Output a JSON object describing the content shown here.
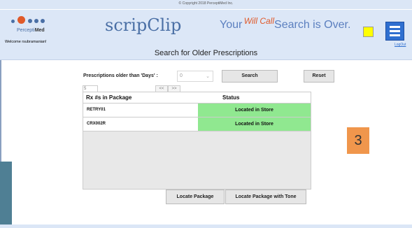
{
  "copyright": "© Copyright 2018 PerceptiMed Inc.",
  "logo": {
    "prefix": "Percepti",
    "suffix": "Med"
  },
  "welcome": "Welcome rsubramanian!",
  "brand": "scripClip",
  "tagline": {
    "prefix": "Your ",
    "accent": "Will Call",
    "text": "Search is Over."
  },
  "logout": "LogOut",
  "page_title": "Search for Older Prescriptions",
  "filter": {
    "label": "Prescriptions older than 'Days' :",
    "days_value": "0",
    "search_label": "Search",
    "reset_label": "Reset"
  },
  "pager": {
    "page_size": "5",
    "prev": "<<",
    "next": ">>"
  },
  "table": {
    "headers": [
      "Rx #s in Package",
      "Status"
    ],
    "rows": [
      {
        "rx": "RETRY01",
        "status": "Located in Store"
      },
      {
        "rx": "CRX002R",
        "status": "Located in Store"
      }
    ]
  },
  "actions": {
    "locate_package": "Locate Package",
    "locate_package_tone": "Locate Package with Tone"
  },
  "badge": "3",
  "colors": {
    "header_bg": "#dce7f7",
    "brand_blue": "#4a6fa5",
    "status_green": "#90e890",
    "badge_orange": "#f0964c",
    "menu_blue": "#2f6fd0"
  },
  "icons": {
    "menu": "hamburger-menu-icon",
    "indicator": "yellow-square-icon"
  }
}
